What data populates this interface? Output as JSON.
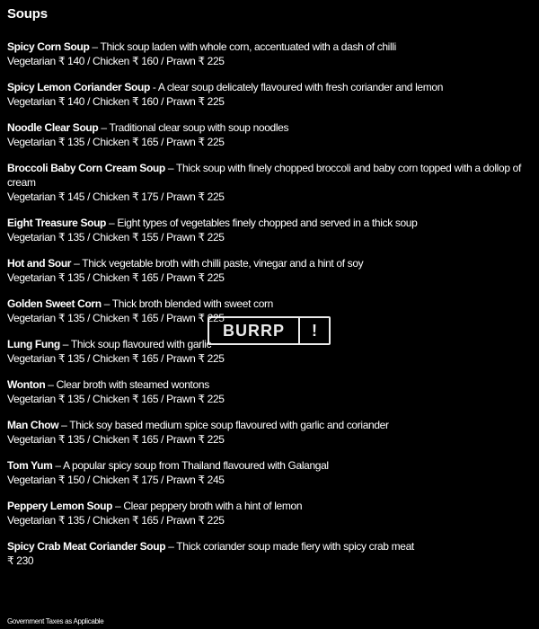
{
  "menu": {
    "section_title": "Soups",
    "items": [
      {
        "name": "Spicy Corn Soup",
        "desc": " – Thick soup laden with whole corn, accentuated with a dash of chilli",
        "price": "Vegetarian ₹ 140 / Chicken ₹ 160 / Prawn ₹ 225"
      },
      {
        "name": "Spicy Lemon Coriander Soup",
        "desc": " - A clear soup delicately flavoured with fresh coriander and lemon",
        "price": "Vegetarian ₹ 140 / Chicken ₹ 160 / Prawn ₹ 225"
      },
      {
        "name": "Noodle Clear Soup",
        "desc": " – Traditional clear soup with soup noodles",
        "price": "Vegetarian ₹ 135 / Chicken ₹ 165 / Prawn ₹ 225"
      },
      {
        "name": "Broccoli Baby Corn Cream Soup",
        "desc": " – Thick soup with finely chopped broccoli and baby corn topped with a dollop of cream",
        "price": "Vegetarian ₹ 145 / Chicken ₹ 175 / Prawn ₹ 225"
      },
      {
        "name": "Eight Treasure Soup",
        "desc": " – Eight types of vegetables finely chopped and served in a thick soup",
        "price": "Vegetarian ₹ 135 / Chicken ₹ 155 / Prawn ₹ 225"
      },
      {
        "name": "Hot and Sour",
        "desc": " – Thick vegetable broth with chilli paste, vinegar and a hint of soy",
        "price": "Vegetarian ₹ 135 / Chicken ₹ 165 / Prawn ₹ 225"
      },
      {
        "name": "Golden Sweet Corn",
        "desc": " – Thick broth blended with sweet corn",
        "price": "Vegetarian ₹ 135 / Chicken ₹ 165 / Prawn ₹ 225"
      },
      {
        "name": "Lung Fung",
        "desc": " – Thick soup flavoured with garlic",
        "price": "Vegetarian ₹ 135 / Chicken ₹ 165 / Prawn ₹ 225"
      },
      {
        "name": "Wonton",
        "desc": " – Clear broth with steamed wontons",
        "price": "Vegetarian ₹ 135 / Chicken ₹ 165 / Prawn ₹ 225"
      },
      {
        "name": "Man Chow",
        "desc": " – Thick soy based medium spice soup flavoured with garlic and coriander",
        "price": "Vegetarian ₹ 135 / Chicken ₹ 165 / Prawn ₹ 225"
      },
      {
        "name": "Tom Yum",
        "desc": " – A popular spicy soup from Thailand flavoured with Galangal",
        "price": "Vegetarian ₹ 150 / Chicken ₹ 175 / Prawn ₹ 245"
      },
      {
        "name": "Peppery Lemon Soup",
        "desc": " – Clear peppery broth with a hint of lemon",
        "price": "Vegetarian ₹ 135 / Chicken ₹ 165 / Prawn ₹ 225"
      },
      {
        "name": "Spicy Crab Meat Coriander Soup",
        "desc": " – Thick coriander soup made fiery with spicy crab meat",
        "price": "₹ 230"
      }
    ],
    "footer_note": "Government Taxes as Applicable"
  },
  "watermark": {
    "brand": "BURRP",
    "mark": "!"
  },
  "colors": {
    "background": "#000000",
    "text": "#ffffff"
  }
}
